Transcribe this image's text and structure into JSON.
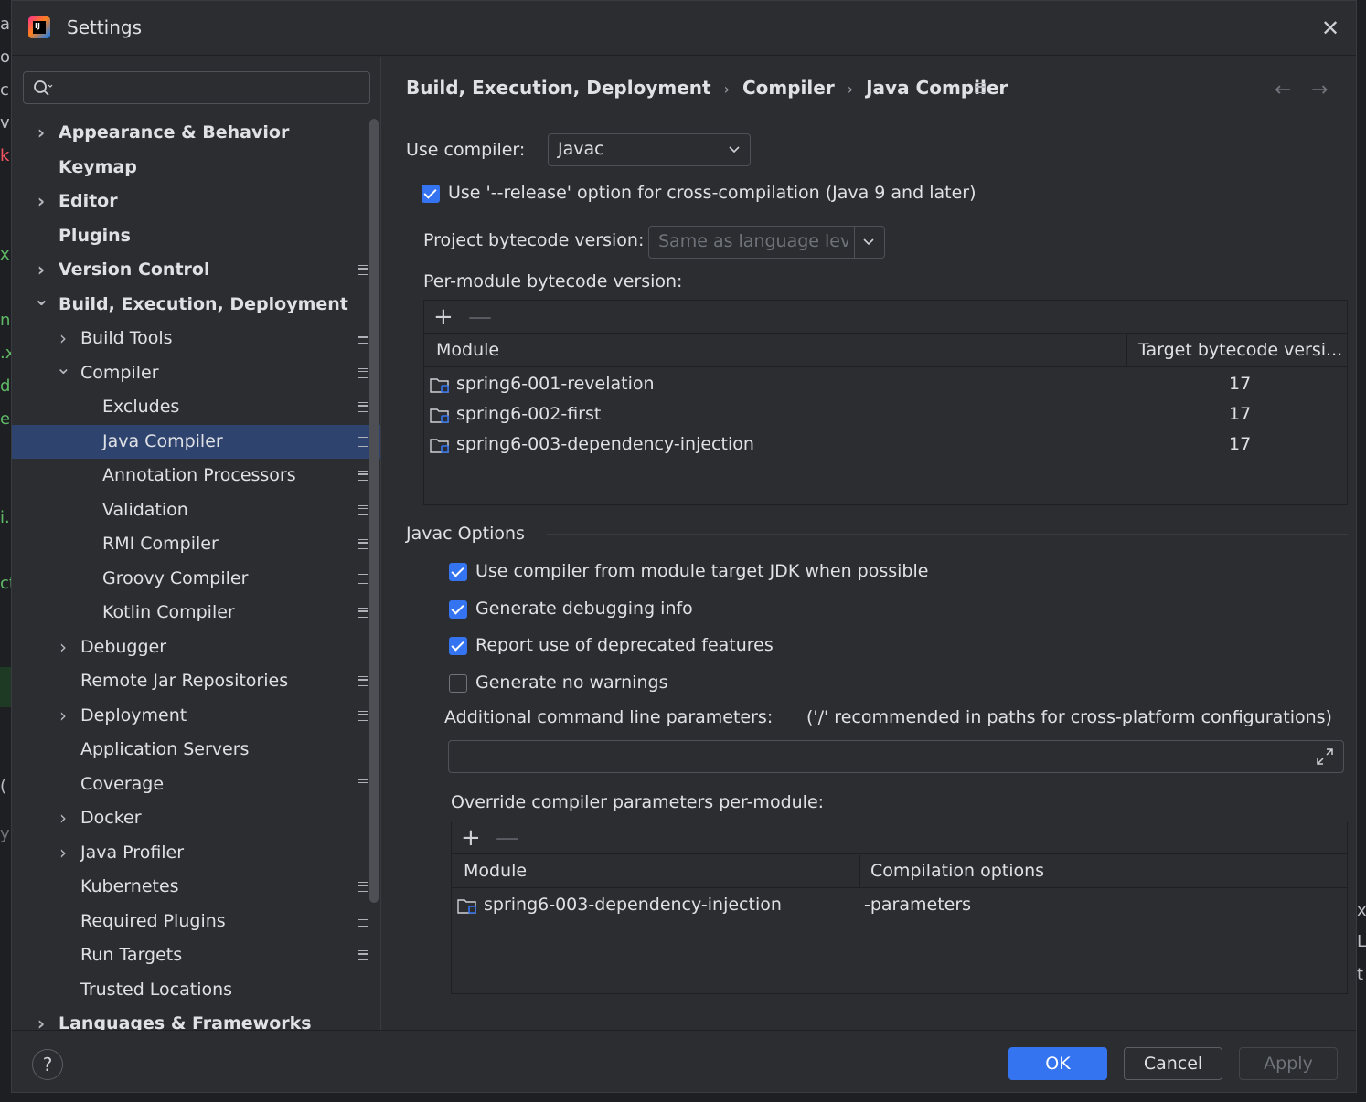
{
  "window": {
    "title": "Settings"
  },
  "search": {
    "placeholder": ""
  },
  "sidebar": {
    "items": [
      {
        "label": "Appearance & Behavior",
        "level": 0,
        "chevron": "right",
        "proj": false
      },
      {
        "label": "Keymap",
        "level": 0,
        "chevron": "",
        "proj": false
      },
      {
        "label": "Editor",
        "level": 0,
        "chevron": "right",
        "proj": false
      },
      {
        "label": "Plugins",
        "level": 0,
        "chevron": "",
        "proj": false
      },
      {
        "label": "Version Control",
        "level": 0,
        "chevron": "right",
        "proj": true
      },
      {
        "label": "Build, Execution, Deployment",
        "level": 0,
        "chevron": "down",
        "proj": false
      },
      {
        "label": "Build Tools",
        "level": 1,
        "chevron": "right",
        "proj": true
      },
      {
        "label": "Compiler",
        "level": 1,
        "chevron": "down",
        "proj": true
      },
      {
        "label": "Excludes",
        "level": 2,
        "chevron": "",
        "proj": true
      },
      {
        "label": "Java Compiler",
        "level": 2,
        "chevron": "",
        "proj": true,
        "selected": true
      },
      {
        "label": "Annotation Processors",
        "level": 2,
        "chevron": "",
        "proj": true
      },
      {
        "label": "Validation",
        "level": 2,
        "chevron": "",
        "proj": true
      },
      {
        "label": "RMI Compiler",
        "level": 2,
        "chevron": "",
        "proj": true
      },
      {
        "label": "Groovy Compiler",
        "level": 2,
        "chevron": "",
        "proj": true
      },
      {
        "label": "Kotlin Compiler",
        "level": 2,
        "chevron": "",
        "proj": true
      },
      {
        "label": "Debugger",
        "level": 1,
        "chevron": "right",
        "proj": false
      },
      {
        "label": "Remote Jar Repositories",
        "level": 1,
        "chevron": "",
        "proj": true
      },
      {
        "label": "Deployment",
        "level": 1,
        "chevron": "right",
        "proj": true
      },
      {
        "label": "Application Servers",
        "level": 1,
        "chevron": "",
        "proj": false
      },
      {
        "label": "Coverage",
        "level": 1,
        "chevron": "",
        "proj": true
      },
      {
        "label": "Docker",
        "level": 1,
        "chevron": "right",
        "proj": false
      },
      {
        "label": "Java Profiler",
        "level": 1,
        "chevron": "right",
        "proj": false
      },
      {
        "label": "Kubernetes",
        "level": 1,
        "chevron": "",
        "proj": true
      },
      {
        "label": "Required Plugins",
        "level": 1,
        "chevron": "",
        "proj": true
      },
      {
        "label": "Run Targets",
        "level": 1,
        "chevron": "",
        "proj": true
      },
      {
        "label": "Trusted Locations",
        "level": 1,
        "chevron": "",
        "proj": false
      },
      {
        "label": "Languages & Frameworks",
        "level": 0,
        "chevron": "right",
        "proj": false
      }
    ]
  },
  "breadcrumb": {
    "part1": "Build, Execution, Deployment",
    "part2": "Compiler",
    "part3": "Java Compiler",
    "sep": "›"
  },
  "nav": {
    "back": "←",
    "forward": "→"
  },
  "compiler": {
    "use_compiler_label": "Use compiler:",
    "use_compiler_value": "Javac",
    "release_option_label": "Use '--release' option for cross-compilation (Java 9 and later)",
    "release_option_checked": true,
    "project_bytecode_label": "Project bytecode version:",
    "project_bytecode_value": "Same as language leve",
    "per_module_label": "Per-module bytecode version:",
    "per_module_table": {
      "col_module": "Module",
      "col_target": "Target bytecode versi...",
      "rows": [
        {
          "module": "spring6-001-revelation",
          "target": "17"
        },
        {
          "module": "spring6-002-first",
          "target": "17"
        },
        {
          "module": "spring6-003-dependency-injection",
          "target": "17"
        }
      ]
    }
  },
  "javac_options": {
    "section_title": "Javac Options",
    "options": [
      {
        "label": "Use compiler from module target JDK when possible",
        "checked": true
      },
      {
        "label": "Generate debugging info",
        "checked": true
      },
      {
        "label": "Report use of deprecated features",
        "checked": true
      },
      {
        "label": "Generate no warnings",
        "checked": false
      }
    ],
    "additional_params_label": "Additional command line parameters:",
    "additional_params_hint": "('/' recommended in paths for cross-platform configurations)",
    "additional_params_value": "",
    "override_label": "Override compiler parameters per-module:",
    "override_table": {
      "col_module": "Module",
      "col_options": "Compilation options",
      "rows": [
        {
          "module": "spring6-003-dependency-injection",
          "options": "-parameters"
        }
      ]
    }
  },
  "toolbar": {
    "plus": "+",
    "minus": "—"
  },
  "footer": {
    "help": "?",
    "ok": "OK",
    "cancel": "Cancel",
    "apply": "Apply"
  },
  "background": {
    "left_chars": [
      "ar",
      "o",
      "c",
      "vi",
      "k.",
      "xr",
      "n",
      ".x",
      "d",
      "e",
      "i.:",
      "ct",
      "(",
      "yb"
    ],
    "right_chars": [
      "x",
      "L",
      "t"
    ]
  },
  "colors": {
    "accent": "#3574f0",
    "selection": "#2e436e",
    "panel": "#2b2d30",
    "text": "#dfe1e5"
  }
}
